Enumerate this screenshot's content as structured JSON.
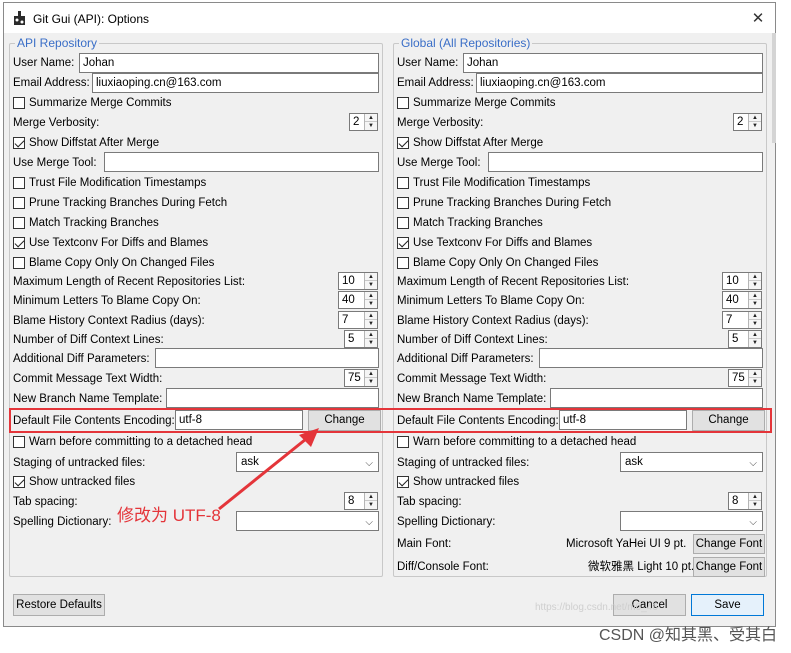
{
  "window": {
    "title": "Git Gui (API): Options"
  },
  "left": {
    "legend": "API Repository",
    "user_name_label": "User Name:",
    "user_name": "Johan",
    "email_label": "Email Address:",
    "email": "liuxiaoping.cn@163.com",
    "summarize_label": "Summarize Merge Commits",
    "merge_verbosity_label": "Merge Verbosity:",
    "merge_verbosity": "2",
    "diffstat_label": "Show Diffstat After Merge",
    "merge_tool_label": "Use Merge Tool:",
    "trust_label": "Trust File Modification Timestamps",
    "prune_label": "Prune Tracking Branches During Fetch",
    "match_label": "Match Tracking Branches",
    "textconv_label": "Use Textconv For Diffs and Blames",
    "blame_copy_label": "Blame Copy Only On Changed Files",
    "max_recent_label": "Maximum Length of Recent Repositories List:",
    "max_recent": "10",
    "min_letters_label": "Minimum Letters To Blame Copy On:",
    "min_letters": "40",
    "blame_history_label": "Blame History Context Radius (days):",
    "blame_history": "7",
    "diff_context_label": "Number of Diff Context Lines:",
    "diff_context": "5",
    "additional_diff_label": "Additional Diff Parameters:",
    "commit_width_label": "Commit Message Text Width:",
    "commit_width": "75",
    "branch_template_label": "New Branch Name Template:",
    "encoding_label": "Default File Contents Encoding:",
    "encoding": "utf-8",
    "change_label": "Change",
    "warn_detached_label": "Warn before committing to a detached head",
    "staging_label": "Staging of untracked files:",
    "staging": "ask",
    "show_untracked_label": "Show untracked files",
    "tab_spacing_label": "Tab spacing:",
    "tab_spacing": "8",
    "spelling_label": "Spelling Dictionary:"
  },
  "right": {
    "legend": "Global (All Repositories)",
    "user_name_label": "User Name:",
    "user_name": "Johan",
    "email_label": "Email Address:",
    "email": "liuxiaoping.cn@163.com",
    "summarize_label": "Summarize Merge Commits",
    "merge_verbosity_label": "Merge Verbosity:",
    "merge_verbosity": "2",
    "diffstat_label": "Show Diffstat After Merge",
    "merge_tool_label": "Use Merge Tool:",
    "trust_label": "Trust File Modification Timestamps",
    "prune_label": "Prune Tracking Branches During Fetch",
    "match_label": "Match Tracking Branches",
    "textconv_label": "Use Textconv For Diffs and Blames",
    "blame_copy_label": "Blame Copy Only On Changed Files",
    "max_recent_label": "Maximum Length of Recent Repositories List:",
    "max_recent": "10",
    "min_letters_label": "Minimum Letters To Blame Copy On:",
    "min_letters": "40",
    "blame_history_label": "Blame History Context Radius (days):",
    "blame_history": "7",
    "diff_context_label": "Number of Diff Context Lines:",
    "diff_context": "5",
    "additional_diff_label": "Additional Diff Parameters:",
    "commit_width_label": "Commit Message Text Width:",
    "commit_width": "75",
    "branch_template_label": "New Branch Name Template:",
    "encoding_label": "Default File Contents Encoding:",
    "encoding": "utf-8",
    "change_label": "Change",
    "warn_detached_label": "Warn before committing to a detached head",
    "staging_label": "Staging of untracked files:",
    "staging": "ask",
    "show_untracked_label": "Show untracked files",
    "tab_spacing_label": "Tab spacing:",
    "tab_spacing": "8",
    "spelling_label": "Spelling Dictionary:",
    "main_font_label": "Main Font:",
    "main_font": "Microsoft YaHei UI 9 pt.",
    "diff_font_label": "Diff/Console Font:",
    "diff_font": "微软雅黑 Light 10 pt.",
    "change_font_label": "Change Font"
  },
  "footer": {
    "restore": "Restore Defaults",
    "cancel": "Cancel",
    "save": "Save"
  },
  "annotation": {
    "text": "修改为 UTF-8",
    "color": "#e4353a"
  },
  "watermark": "CSDN @知其黑、受其白",
  "watermark_faint": "https://blog.csdn.net/m0_46"
}
